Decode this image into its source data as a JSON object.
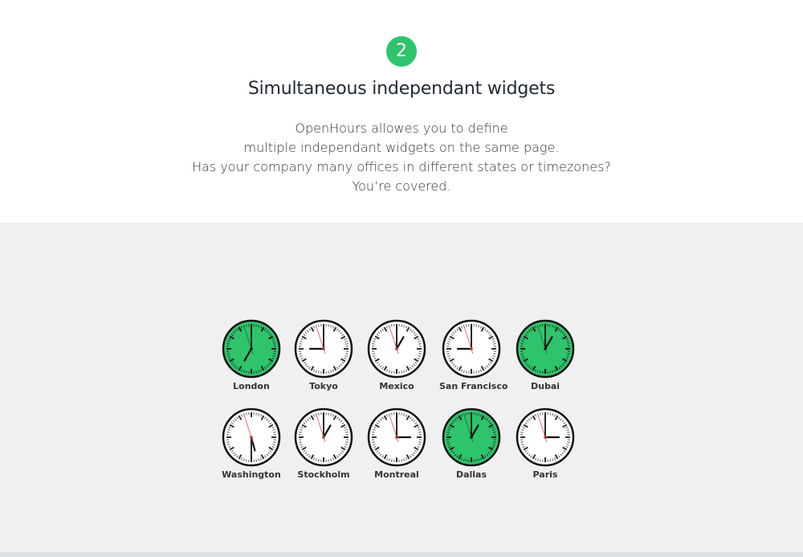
{
  "step_number": "2",
  "heading": "Simultaneous independant widgets",
  "description": [
    "OpenHours allowes you to define",
    "multiple independant widgets on the same page.",
    "Has your company many offices in different states or timezones?",
    "You’re covered."
  ],
  "colors": {
    "accent": "#2ec46c",
    "open_face": "#2ec46c",
    "closed_face": "#ffffff",
    "second_hand": "#e05050"
  },
  "clocks": [
    {
      "city": "London",
      "time": "7:00",
      "seconds": 57,
      "open": true
    },
    {
      "city": "Tokyo",
      "time": "9:00",
      "seconds": 57,
      "open": false
    },
    {
      "city": "Mexico",
      "time": "1:00",
      "seconds": 57,
      "open": false
    },
    {
      "city": "San Francisco",
      "time": "9:00",
      "seconds": 57,
      "open": false
    },
    {
      "city": "Dubai",
      "time": "1:00",
      "seconds": 57,
      "open": true
    },
    {
      "city": "Washington",
      "time": "5:30",
      "seconds": 57,
      "open": false
    },
    {
      "city": "Stockholm",
      "time": "1:00",
      "seconds": 57,
      "open": false
    },
    {
      "city": "Montreal",
      "time": "3:00",
      "seconds": 57,
      "open": false
    },
    {
      "city": "Dallas",
      "time": "1:00",
      "seconds": 57,
      "open": true
    },
    {
      "city": "Paris",
      "time": "3:00",
      "seconds": 57,
      "open": false
    }
  ]
}
